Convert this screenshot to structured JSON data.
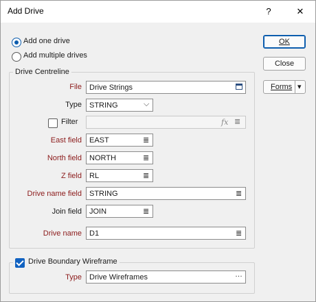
{
  "window": {
    "title": "Add Drive",
    "help": "?",
    "close": "✕"
  },
  "mode": {
    "one": "Add one drive",
    "multiple": "Add multiple drives",
    "selected": "one"
  },
  "buttons": {
    "ok": "OK",
    "close": "Close",
    "forms": "Forms",
    "forms_arrow": "▾"
  },
  "centreline": {
    "title": "Drive Centreline",
    "file_label": "File",
    "file_value": "Drive Strings",
    "type_label": "Type",
    "type_value": "STRING",
    "filter_label": "Filter",
    "filter_value": "",
    "filter_fx": "fx",
    "east_label": "East field",
    "east_value": "EAST",
    "north_label": "North field",
    "north_value": "NORTH",
    "z_label": "Z field",
    "z_value": "RL",
    "drive_name_field_label": "Drive name field",
    "drive_name_field_value": "STRING",
    "join_label": "Join field",
    "join_value": "JOIN",
    "drive_name_label": "Drive name",
    "drive_name_value": "D1"
  },
  "boundary": {
    "title": "Drive Boundary Wireframe",
    "checked": true,
    "type_label": "Type",
    "type_value": "Drive Wireframes"
  },
  "icons": {
    "list": "≣",
    "chevron": "⌵",
    "browse": "▭",
    "ellipsis": "…"
  }
}
